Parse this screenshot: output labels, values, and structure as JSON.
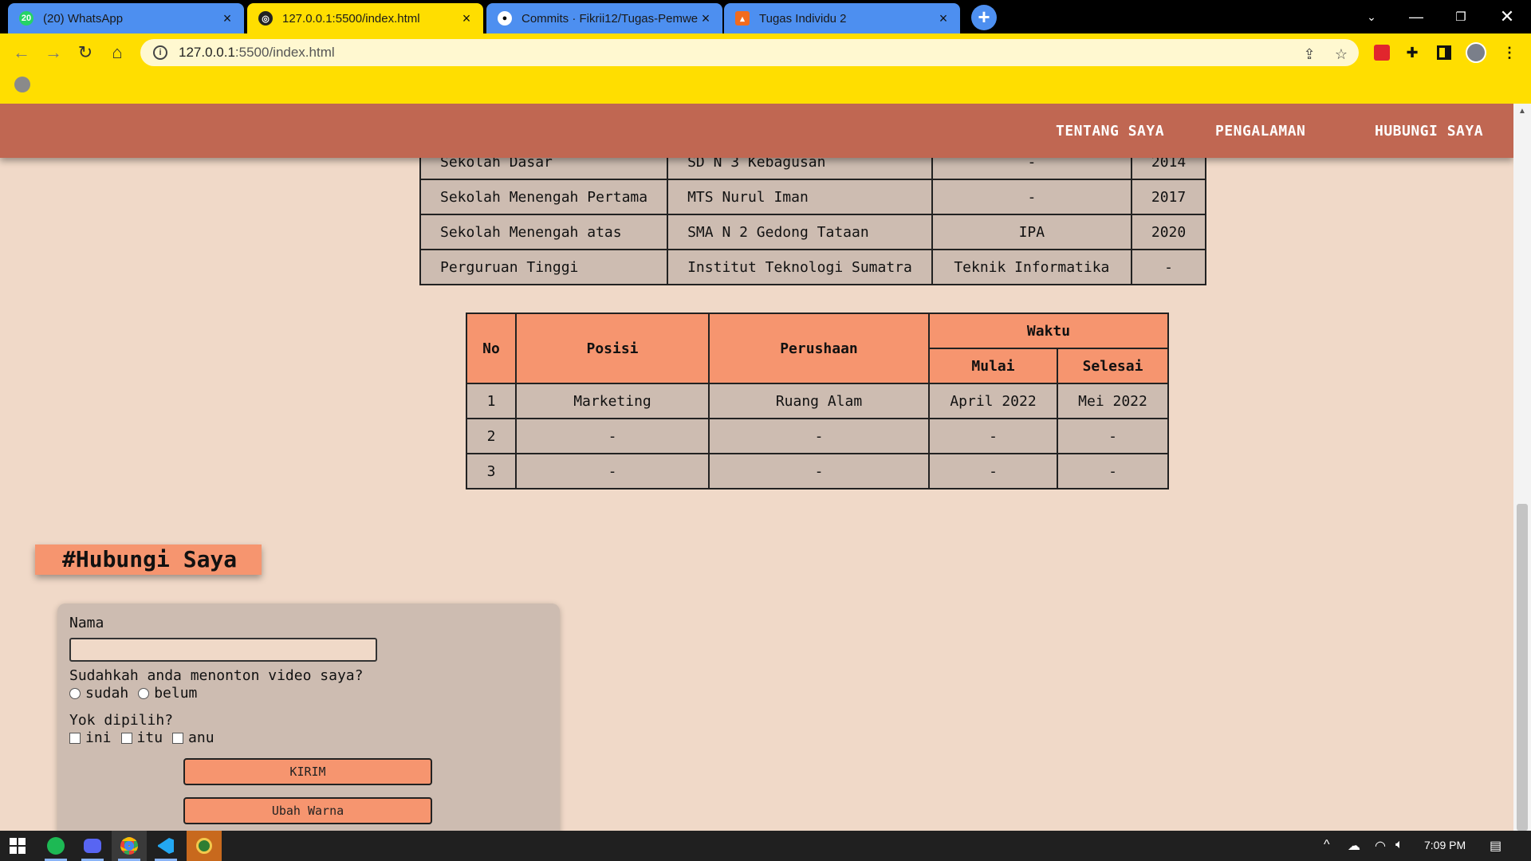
{
  "browser": {
    "tabs": [
      {
        "title": "(20) WhatsApp",
        "badge": "20"
      },
      {
        "title": "127.0.0.1:5500/index.html"
      },
      {
        "title": "Commits · Fikrii12/Tugas-Pemwe"
      },
      {
        "title": "Tugas Individu 2"
      }
    ],
    "address": {
      "host": "127.0.0.1",
      "path": ":5500/index.html"
    }
  },
  "nav": {
    "items": [
      "TENTANG SAYA",
      "PENGALAMAN",
      "HUBUNGI SAYA"
    ]
  },
  "education": {
    "rows": [
      [
        "Sekolah Dasar",
        "SD N 3 Kebagusan",
        "-",
        "2014"
      ],
      [
        "Sekolah Menengah Pertama",
        "MTS Nurul Iman",
        "-",
        "2017"
      ],
      [
        "Sekolah Menengah atas",
        "SMA N 2 Gedong Tataan",
        "IPA",
        "2020"
      ],
      [
        "Perguruan Tinggi",
        "Institut Teknologi Sumatra",
        "Teknik Informatika",
        "-"
      ]
    ]
  },
  "experience": {
    "headers": {
      "no": "No",
      "posisi": "Posisi",
      "perusahaan": "Perushaan",
      "waktu": "Waktu",
      "mulai": "Mulai",
      "selesai": "Selesai"
    },
    "rows": [
      [
        "1",
        "Marketing",
        "Ruang Alam",
        "April 2022",
        "Mei 2022"
      ],
      [
        "2",
        "-",
        "-",
        "-",
        "-"
      ],
      [
        "3",
        "-",
        "-",
        "-",
        "-"
      ]
    ]
  },
  "contact": {
    "title": "#Hubungi Saya",
    "name_label": "Nama",
    "name_value": "",
    "video_question": "Sudahkah anda menonton video saya?",
    "video_options": [
      "sudah",
      "belum"
    ],
    "pick_label": "Yok dipilih?",
    "pick_options": [
      "ini",
      "itu",
      "anu"
    ],
    "submit_label": "KIRIM",
    "color_label": "Ubah Warna"
  },
  "taskbar": {
    "time": "7:09 PM"
  },
  "colors": {
    "chrome_accent": "#ffde00",
    "tab_inactive": "#4d8ff0",
    "nav_bg": "#c06752",
    "page_bg": "#f0d9c8",
    "table_cell": "#cdbcb1",
    "table_header": "#f6956f"
  }
}
